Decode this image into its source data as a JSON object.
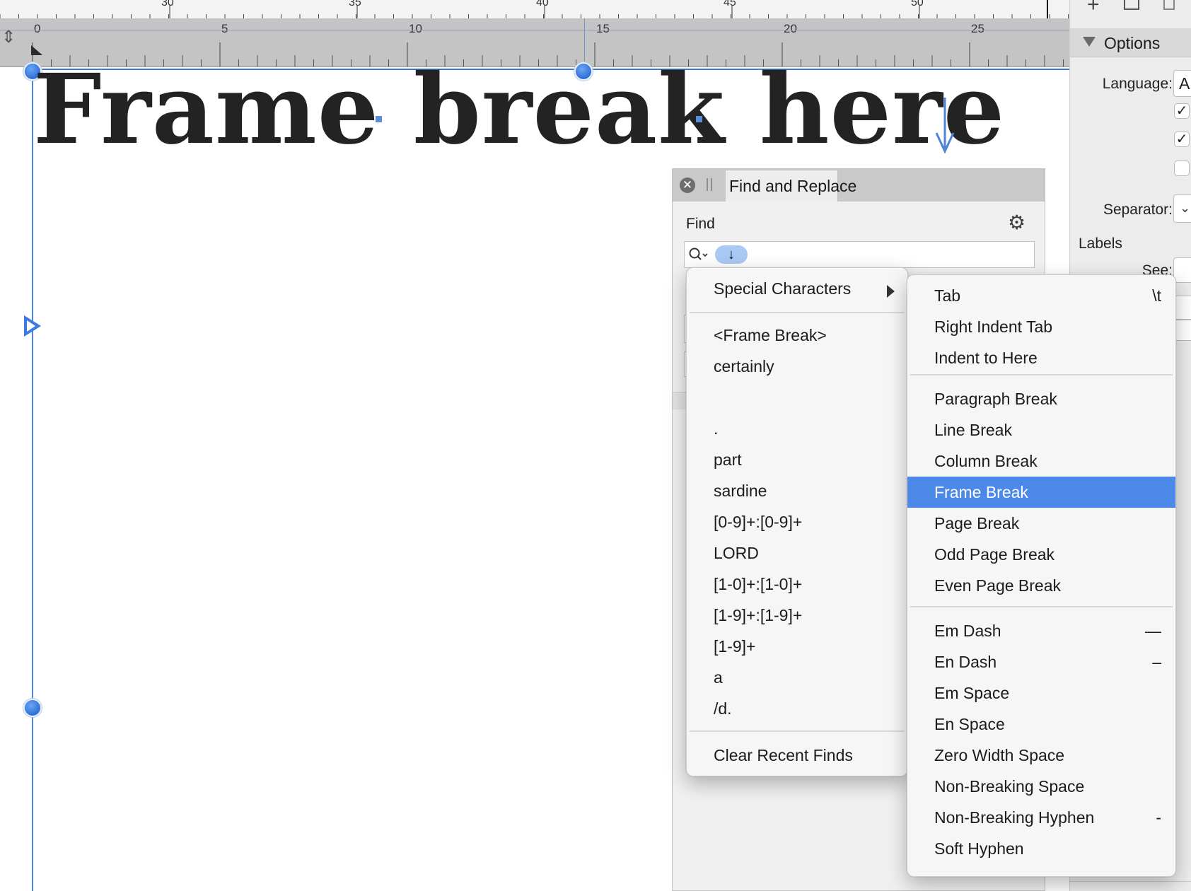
{
  "ruler_top": {
    "labels": [
      "30",
      "35",
      "40",
      "45",
      "50"
    ]
  },
  "ruler_main": {
    "labels": [
      "0",
      "5",
      "10",
      "15",
      "20",
      "25"
    ]
  },
  "document": {
    "heading": "Frame break here"
  },
  "options_panel": {
    "title": "Options",
    "language_label": "Language:",
    "language_value": "A",
    "separator_label": "Separator:",
    "labels_heading": "Labels",
    "see_label": "See:",
    "checkboxes": [
      true,
      true,
      false
    ]
  },
  "find_replace": {
    "tab_title": "Find and Replace",
    "find_label": "Find",
    "search_token": "↓"
  },
  "recent_menu": {
    "special_characters": "Special Characters",
    "recent_items": [
      "<Frame Break>",
      "certainly",
      "",
      ".",
      "part",
      "sardine",
      "[0-9]+:[0-9]+",
      "LORD",
      "[1-0]+:[1-0]+",
      "[1-9]+:[1-9]+",
      "[1-9]+",
      "a",
      "/d."
    ],
    "clear_label": "Clear Recent Finds"
  },
  "special_menu": {
    "group1": [
      {
        "label": "Tab",
        "shortcut": "\\t"
      },
      {
        "label": "Right Indent Tab",
        "shortcut": ""
      },
      {
        "label": "Indent to Here",
        "shortcut": ""
      }
    ],
    "group2": [
      {
        "label": "Paragraph Break",
        "shortcut": ""
      },
      {
        "label": "Line Break",
        "shortcut": ""
      },
      {
        "label": "Column Break",
        "shortcut": ""
      },
      {
        "label": "Frame Break",
        "shortcut": "",
        "highlighted": true
      },
      {
        "label": "Page Break",
        "shortcut": ""
      },
      {
        "label": "Odd Page Break",
        "shortcut": ""
      },
      {
        "label": "Even Page Break",
        "shortcut": ""
      }
    ],
    "group3": [
      {
        "label": "Em Dash",
        "shortcut": "—"
      },
      {
        "label": "En Dash",
        "shortcut": "–"
      },
      {
        "label": "Em Space",
        "shortcut": ""
      },
      {
        "label": "En Space",
        "shortcut": ""
      },
      {
        "label": "Zero Width Space",
        "shortcut": ""
      },
      {
        "label": "Non-Breaking Space",
        "shortcut": ""
      },
      {
        "label": "Non-Breaking Hyphen",
        "shortcut": "-"
      },
      {
        "label": "Soft Hyphen",
        "shortcut": ""
      }
    ]
  },
  "colors": {
    "accent": "#4b88e8",
    "guide": "#3a78d8"
  }
}
